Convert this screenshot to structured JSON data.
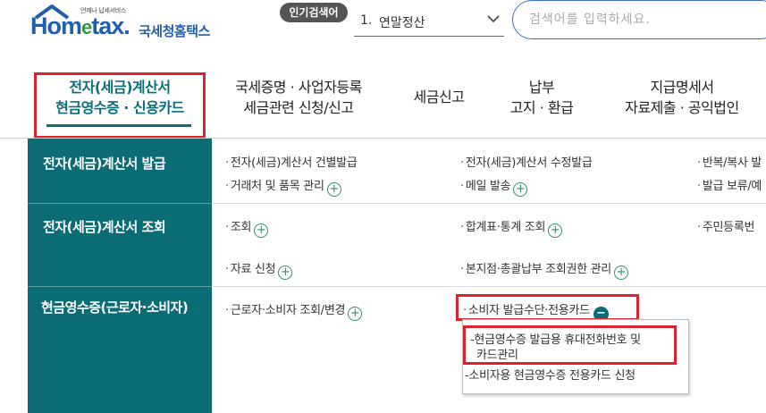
{
  "header": {
    "logo_tagline": "언제나 납세서비스",
    "logo_main_before": "Hom",
    "logo_main_e": "e",
    "logo_main_after": "tax.",
    "logo_korean": "국세청홈택스",
    "popular_badge": "인기검색어",
    "popular_rank": "1.",
    "popular_term": "연말정산",
    "search_placeholder": "검색어를 입력하세요."
  },
  "nav": {
    "items": [
      {
        "line1": "전자(세금)계산서",
        "line2": "현금영수증 · 신용카드"
      },
      {
        "line1": "국세증명 · 사업자등록",
        "line2": "세금관련 신청/신고"
      },
      {
        "line1": "세금신고",
        "line2": ""
      },
      {
        "line1": "납부",
        "line2": "고지 · 환급"
      },
      {
        "line1": "지급명세서",
        "line2": "자료제출 · 공익법인"
      }
    ]
  },
  "menu": {
    "sections": [
      {
        "label": "전자(세금)계산서 발급"
      },
      {
        "label": "전자(세금)계산서 조회"
      },
      {
        "label": "현금영수증(근로자·소비자)"
      }
    ],
    "links": {
      "issue_single": "전자(세금)계산서 건별발급",
      "issue_modify": "전자(세금)계산서 수정발급",
      "issue_return": "반복/복사 발",
      "partner_mgmt": "거래처 및 품목 관리",
      "mail_send": "메일 발송",
      "issue_hold": "발급 보류/예",
      "query": "조회",
      "summary_stats": "합계표·통계 조회",
      "resident_no": "주민등록번",
      "data_request": "자료 신청",
      "branch_query": "본지점·총괄납부 조회권한 관리",
      "worker_query": "근로자·소비자 조회/변경",
      "consumer_card": "소비자 발급수단·전용카드"
    },
    "submenu": {
      "item1_line1": "현금영수증 발급용 휴대전화번호 및",
      "item1_line2": "카드관리",
      "item2": "소비자용 현금영수증 전용카드 신청"
    },
    "plus_symbol": "+",
    "minus_symbol": "−",
    "dash_symbol": "-",
    "dot_symbol": "·"
  },
  "colors": {
    "brand_blue": "#1f5fae",
    "teal": "#0a6c75",
    "highlight_red": "#d9232e"
  }
}
